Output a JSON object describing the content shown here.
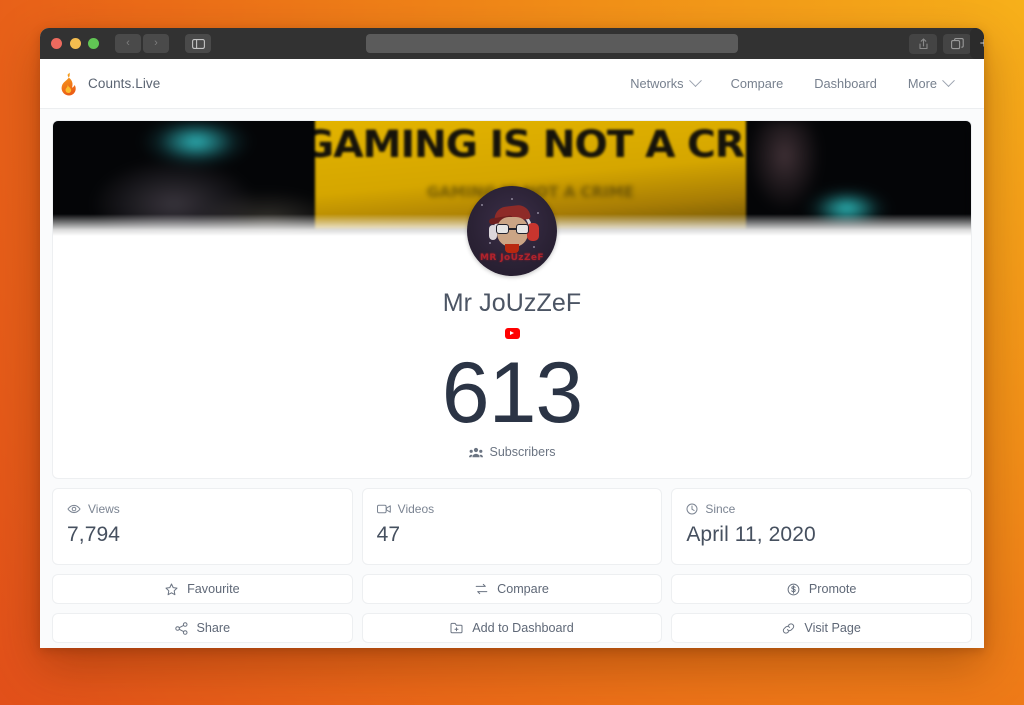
{
  "browser": {
    "url_value": "",
    "url_placeholder": "",
    "back_glyph": "‹",
    "forward_glyph": "›",
    "sidebar_glyph": "▣",
    "share_glyph": "⤴",
    "tabs_glyph": "❐",
    "newtab_glyph": "+"
  },
  "site_header": {
    "brand_label": "Counts.Live",
    "logo_icon": "flame-icon",
    "nav": [
      {
        "label": "Networks",
        "has_caret": true
      },
      {
        "label": "Compare",
        "has_caret": false
      },
      {
        "label": "Dashboard",
        "has_caret": false
      },
      {
        "label": "More",
        "has_caret": true
      }
    ]
  },
  "profile": {
    "banner_text": "GAMING IS NOT A CRIME",
    "banner_subtext": "GAMING IS NOT A CRIME",
    "avatar_name": "MR JoUzZeF",
    "title": "Mr JoUzZeF",
    "network": "youtube",
    "count": "613",
    "count_label": "Subscribers",
    "count_icon": "users-icon"
  },
  "stats": [
    {
      "icon": "eye-icon",
      "label": "Views",
      "value": "7,794"
    },
    {
      "icon": "video-icon",
      "label": "Videos",
      "value": "47"
    },
    {
      "icon": "clock-icon",
      "label": "Since",
      "value": "April 11, 2020"
    }
  ],
  "actions": [
    {
      "icon": "star-icon",
      "label": "Favourite"
    },
    {
      "icon": "compare-icon",
      "label": "Compare"
    },
    {
      "icon": "dollar-icon",
      "label": "Promote"
    },
    {
      "icon": "share-icon",
      "label": "Share"
    },
    {
      "icon": "dashboard-icon",
      "label": "Add to Dashboard"
    },
    {
      "icon": "link-icon",
      "label": "Visit Page"
    }
  ],
  "colors": {
    "page_background_light": "#F7B01A",
    "page_background_dark": "#E2501A",
    "brand_flame_top": "#F5A623",
    "brand_flame_bottom": "#EF6C17",
    "youtube_red": "#FF0000",
    "count_text": "#2B3445",
    "banner_sign": "#D5A600"
  }
}
